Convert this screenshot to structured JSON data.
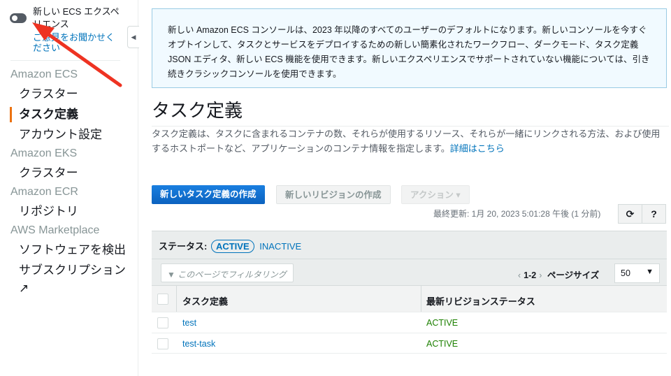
{
  "sidebar": {
    "new_experience": "新しい ECS エクスペリエンス",
    "feedback": "ご意見をお聞かせください",
    "sections": [
      {
        "title": "Amazon ECS",
        "items": [
          "クラスター",
          "タスク定義",
          "アカウント設定"
        ]
      },
      {
        "title": "Amazon EKS",
        "items": [
          "クラスター"
        ]
      },
      {
        "title": "Amazon ECR",
        "items": [
          "リポジトリ"
        ]
      },
      {
        "title": "AWS Marketplace",
        "items": [
          "ソフトウェアを検出",
          "サブスクリプション"
        ]
      }
    ],
    "external_icon": "↗"
  },
  "info": "新しい Amazon ECS コンソールは、2023 年以降のすべてのユーザーのデフォルトになります。新しいコンソールを今すぐオプトインして、タスクとサービスをデプロイするための新しい簡素化されたワークフロー、ダークモード、タスク定義 JSON エディタ、新しい ECS 機能を使用できます。新しいエクスペリエンスでサポートされていない機能については、引き続きクラシックコンソールを使用できます。",
  "page": {
    "title": "タスク定義",
    "description": "タスク定義は、タスクに含まれるコンテナの数、それらが使用するリソース、それらが一緒にリンクされる方法、および使用するホストポートなど、アプリケーションのコンテナ情報を指定します。",
    "details_link": "詳細はこちら"
  },
  "toolbar": {
    "create": "新しいタスク定義の作成",
    "revision": "新しいリビジョンの作成",
    "actions": "アクション ▾",
    "last_updated": "最終更新: 1月 20, 2023 5:01:28 午後 (1 分前)",
    "refresh": "⟳",
    "help": "?"
  },
  "status": {
    "label": "ステータス:",
    "active": "ACTIVE",
    "inactive": "INACTIVE"
  },
  "filter": {
    "placeholder": "このページでフィルタリング"
  },
  "pager": {
    "prev": "‹",
    "range": "1-2",
    "next": "›",
    "page_size_label": "ページサイズ",
    "page_size": "50"
  },
  "table": {
    "columns": [
      "タスク定義",
      "最新リビジョンステータス"
    ],
    "rows": [
      {
        "name": "test",
        "status": "ACTIVE"
      },
      {
        "name": "test-task",
        "status": "ACTIVE"
      }
    ]
  }
}
